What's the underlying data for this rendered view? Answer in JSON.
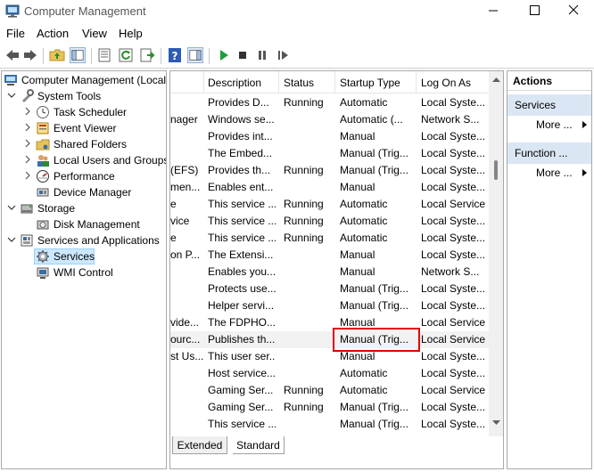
{
  "window": {
    "title": "Computer Management"
  },
  "menu": [
    "File",
    "Action",
    "View",
    "Help"
  ],
  "tree": [
    {
      "label": "Computer Management (Local",
      "level": 0,
      "expander": "",
      "icon": "computer-management-icon"
    },
    {
      "label": "System Tools",
      "level": 1,
      "expander": "open",
      "icon": "system-tools-icon"
    },
    {
      "label": "Task Scheduler",
      "level": 2,
      "expander": "closed",
      "icon": "clock-icon"
    },
    {
      "label": "Event Viewer",
      "level": 2,
      "expander": "closed",
      "icon": "event-viewer-icon"
    },
    {
      "label": "Shared Folders",
      "level": 2,
      "expander": "closed",
      "icon": "shared-folder-icon"
    },
    {
      "label": "Local Users and Groups",
      "level": 2,
      "expander": "closed",
      "icon": "users-icon"
    },
    {
      "label": "Performance",
      "level": 2,
      "expander": "closed",
      "icon": "performance-icon"
    },
    {
      "label": "Device Manager",
      "level": 2,
      "expander": "",
      "icon": "device-manager-icon"
    },
    {
      "label": "Storage",
      "level": 1,
      "expander": "open",
      "icon": "storage-icon"
    },
    {
      "label": "Disk Management",
      "level": 2,
      "expander": "",
      "icon": "disk-icon"
    },
    {
      "label": "Services and Applications",
      "level": 1,
      "expander": "open",
      "icon": "services-apps-icon"
    },
    {
      "label": "Services",
      "level": 2,
      "expander": "",
      "icon": "gear-icon",
      "selected": true
    },
    {
      "label": "WMI Control",
      "level": 2,
      "expander": "",
      "icon": "wmi-icon"
    }
  ],
  "columns": [
    "",
    "Description",
    "Status",
    "Startup Type",
    "Log On As"
  ],
  "rows": [
    [
      "",
      "Provides D...",
      "Running",
      "Automatic",
      "Local Syste..."
    ],
    [
      "nager",
      "Windows se...",
      "",
      "Automatic (...",
      "Network S..."
    ],
    [
      "",
      "Provides int...",
      "",
      "Manual",
      "Local Syste..."
    ],
    [
      "",
      "The Embed...",
      "",
      "Manual (Trig...",
      "Local Syste..."
    ],
    [
      "(EFS)",
      "Provides th...",
      "Running",
      "Manual (Trig...",
      "Local Syste..."
    ],
    [
      "men...",
      "Enables ent...",
      "",
      "Manual",
      "Local Syste..."
    ],
    [
      "e",
      "This service ...",
      "Running",
      "Automatic",
      "Local Service"
    ],
    [
      "vice",
      "This service ...",
      "Running",
      "Automatic",
      "Local Syste..."
    ],
    [
      "e",
      "This service ...",
      "Running",
      "Automatic",
      "Local Syste..."
    ],
    [
      "on P...",
      "The Extensi...",
      "",
      "Manual",
      "Local Syste..."
    ],
    [
      "",
      "Enables you...",
      "",
      "Manual",
      "Network S..."
    ],
    [
      "",
      "Protects use...",
      "",
      "Manual (Trig...",
      "Local Syste..."
    ],
    [
      "",
      "Helper servi...",
      "",
      "Manual (Trig...",
      "Local Syste..."
    ],
    [
      "vide...",
      "The FDPHO...",
      "",
      "Manual",
      "Local Service"
    ],
    [
      "ourc...",
      "Publishes th...",
      "",
      "Manual (Trig...",
      "Local Service"
    ],
    [
      "st Us...",
      "This user ser...",
      "",
      "Manual",
      "Local Syste..."
    ],
    [
      "",
      "Host service...",
      "",
      "Automatic",
      "Local Syste..."
    ],
    [
      "",
      "Gaming Ser...",
      "Running",
      "Automatic",
      "Local Service"
    ],
    [
      "",
      "Gaming Ser...",
      "Running",
      "Manual (Trig...",
      "Local Syste..."
    ],
    [
      "",
      "This service ...",
      "",
      "Manual (Trig...",
      "Local Syste..."
    ]
  ],
  "hover_row": 14,
  "tabs": [
    "Extended",
    "Standard"
  ],
  "actions": {
    "title": "Actions",
    "sections": [
      {
        "label": "Services",
        "more": "More ..."
      },
      {
        "label": "Function ...",
        "more": "More ..."
      }
    ]
  },
  "colors": {
    "selection": "#cce8ff",
    "highlight_box": "#e30000",
    "action_section": "#dbe6f4"
  }
}
